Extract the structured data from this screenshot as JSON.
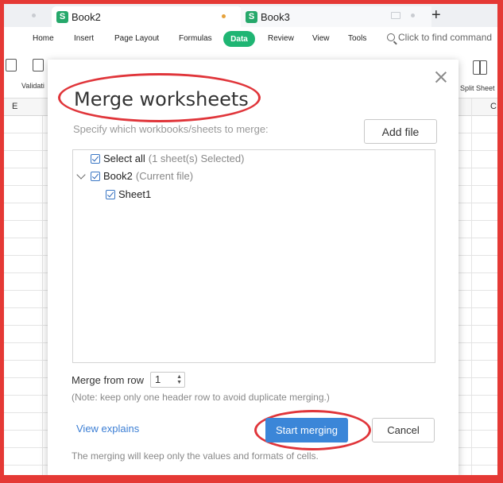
{
  "tabs": [
    {
      "label": "Book2",
      "icon": "spreadsheet-icon",
      "active": true
    },
    {
      "label": "Book3",
      "icon": "spreadsheet-icon",
      "active": false
    }
  ],
  "menu": {
    "items": [
      "Home",
      "Insert",
      "Page Layout",
      "Formulas",
      "Data",
      "Review",
      "View",
      "Tools"
    ],
    "active": "Data",
    "search_placeholder": "Click to find command"
  },
  "toolbar": {
    "validation_label": "Validati",
    "split_sheet_label": "Split Sheet"
  },
  "sheet": {
    "columns": [
      "E",
      "C"
    ]
  },
  "dialog": {
    "title": "Merge worksheets",
    "subtitle": "Specify which workbooks/sheets to merge:",
    "add_file_label": "Add file",
    "tree": {
      "select_all_label": "Select all",
      "select_all_note": "(1 sheet(s) Selected)",
      "workbook_label": "Book2",
      "workbook_note": "(Current file)",
      "sheet_label": "Sheet1"
    },
    "merge_from_row_label": "Merge from row",
    "merge_from_row_value": "1",
    "header_note": "(Note: keep only one header row to avoid duplicate merging.)",
    "view_explains_label": "View explains",
    "start_label": "Start merging",
    "cancel_label": "Cancel",
    "footer_note": "The merging will keep only the values and formats of cells."
  },
  "colors": {
    "accent_green": "#1fb573",
    "primary_blue": "#3b86d8",
    "annotation_red": "#e0353a"
  }
}
